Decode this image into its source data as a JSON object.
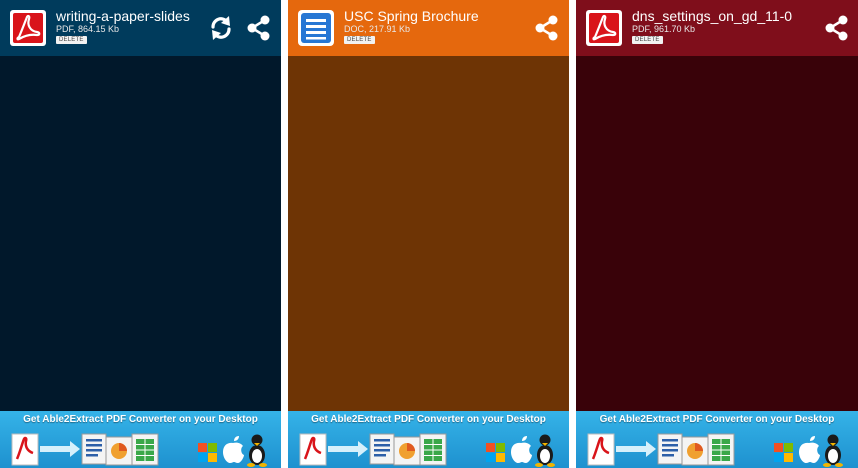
{
  "panels": [
    {
      "title": "writing-a-paper-slides",
      "meta": "PDF, 864.15 Kb",
      "delete_label": "DELETE",
      "file_icon": "pdf-icon",
      "actions": [
        "refresh-icon",
        "share-icon"
      ],
      "header_color": "#003b5c",
      "body_color": "#01182b"
    },
    {
      "title": "USC Spring Brochure",
      "meta": "DOC, 217.91 Kb",
      "delete_label": "DELETE",
      "file_icon": "doc-icon",
      "actions": [
        "share-icon"
      ],
      "header_color": "#e5680d",
      "body_color": "#6e3405"
    },
    {
      "title": "dns_settings_on_gd_11-0",
      "meta": "PDF, 961.70 Kb",
      "delete_label": "DELETE",
      "file_icon": "pdf-icon",
      "actions": [
        "share-icon"
      ],
      "header_color": "#7f0e1b",
      "body_color": "#390209"
    }
  ],
  "banner": {
    "text": "Get Able2Extract PDF Converter on your Desktop",
    "icons": [
      "pdf-icon",
      "arrow-icon",
      "word-icon",
      "presentation-icon",
      "spreadsheet-icon",
      "windows-icon",
      "apple-icon",
      "linux-icon"
    ],
    "background": "#2aa3dd"
  }
}
